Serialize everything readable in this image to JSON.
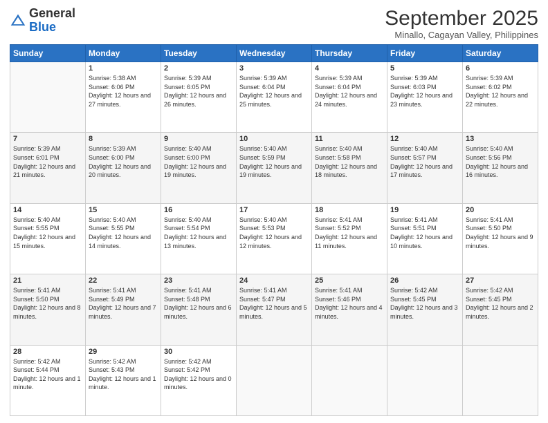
{
  "logo": {
    "general": "General",
    "blue": "Blue"
  },
  "header": {
    "month_title": "September 2025",
    "location": "Minallo, Cagayan Valley, Philippines"
  },
  "days_of_week": [
    "Sunday",
    "Monday",
    "Tuesday",
    "Wednesday",
    "Thursday",
    "Friday",
    "Saturday"
  ],
  "weeks": [
    [
      {
        "day": "",
        "sunrise": "",
        "sunset": "",
        "daylight": ""
      },
      {
        "day": "1",
        "sunrise": "Sunrise: 5:38 AM",
        "sunset": "Sunset: 6:06 PM",
        "daylight": "Daylight: 12 hours and 27 minutes."
      },
      {
        "day": "2",
        "sunrise": "Sunrise: 5:39 AM",
        "sunset": "Sunset: 6:05 PM",
        "daylight": "Daylight: 12 hours and 26 minutes."
      },
      {
        "day": "3",
        "sunrise": "Sunrise: 5:39 AM",
        "sunset": "Sunset: 6:04 PM",
        "daylight": "Daylight: 12 hours and 25 minutes."
      },
      {
        "day": "4",
        "sunrise": "Sunrise: 5:39 AM",
        "sunset": "Sunset: 6:04 PM",
        "daylight": "Daylight: 12 hours and 24 minutes."
      },
      {
        "day": "5",
        "sunrise": "Sunrise: 5:39 AM",
        "sunset": "Sunset: 6:03 PM",
        "daylight": "Daylight: 12 hours and 23 minutes."
      },
      {
        "day": "6",
        "sunrise": "Sunrise: 5:39 AM",
        "sunset": "Sunset: 6:02 PM",
        "daylight": "Daylight: 12 hours and 22 minutes."
      }
    ],
    [
      {
        "day": "7",
        "sunrise": "Sunrise: 5:39 AM",
        "sunset": "Sunset: 6:01 PM",
        "daylight": "Daylight: 12 hours and 21 minutes."
      },
      {
        "day": "8",
        "sunrise": "Sunrise: 5:39 AM",
        "sunset": "Sunset: 6:00 PM",
        "daylight": "Daylight: 12 hours and 20 minutes."
      },
      {
        "day": "9",
        "sunrise": "Sunrise: 5:40 AM",
        "sunset": "Sunset: 6:00 PM",
        "daylight": "Daylight: 12 hours and 19 minutes."
      },
      {
        "day": "10",
        "sunrise": "Sunrise: 5:40 AM",
        "sunset": "Sunset: 5:59 PM",
        "daylight": "Daylight: 12 hours and 19 minutes."
      },
      {
        "day": "11",
        "sunrise": "Sunrise: 5:40 AM",
        "sunset": "Sunset: 5:58 PM",
        "daylight": "Daylight: 12 hours and 18 minutes."
      },
      {
        "day": "12",
        "sunrise": "Sunrise: 5:40 AM",
        "sunset": "Sunset: 5:57 PM",
        "daylight": "Daylight: 12 hours and 17 minutes."
      },
      {
        "day": "13",
        "sunrise": "Sunrise: 5:40 AM",
        "sunset": "Sunset: 5:56 PM",
        "daylight": "Daylight: 12 hours and 16 minutes."
      }
    ],
    [
      {
        "day": "14",
        "sunrise": "Sunrise: 5:40 AM",
        "sunset": "Sunset: 5:55 PM",
        "daylight": "Daylight: 12 hours and 15 minutes."
      },
      {
        "day": "15",
        "sunrise": "Sunrise: 5:40 AM",
        "sunset": "Sunset: 5:55 PM",
        "daylight": "Daylight: 12 hours and 14 minutes."
      },
      {
        "day": "16",
        "sunrise": "Sunrise: 5:40 AM",
        "sunset": "Sunset: 5:54 PM",
        "daylight": "Daylight: 12 hours and 13 minutes."
      },
      {
        "day": "17",
        "sunrise": "Sunrise: 5:40 AM",
        "sunset": "Sunset: 5:53 PM",
        "daylight": "Daylight: 12 hours and 12 minutes."
      },
      {
        "day": "18",
        "sunrise": "Sunrise: 5:41 AM",
        "sunset": "Sunset: 5:52 PM",
        "daylight": "Daylight: 12 hours and 11 minutes."
      },
      {
        "day": "19",
        "sunrise": "Sunrise: 5:41 AM",
        "sunset": "Sunset: 5:51 PM",
        "daylight": "Daylight: 12 hours and 10 minutes."
      },
      {
        "day": "20",
        "sunrise": "Sunrise: 5:41 AM",
        "sunset": "Sunset: 5:50 PM",
        "daylight": "Daylight: 12 hours and 9 minutes."
      }
    ],
    [
      {
        "day": "21",
        "sunrise": "Sunrise: 5:41 AM",
        "sunset": "Sunset: 5:50 PM",
        "daylight": "Daylight: 12 hours and 8 minutes."
      },
      {
        "day": "22",
        "sunrise": "Sunrise: 5:41 AM",
        "sunset": "Sunset: 5:49 PM",
        "daylight": "Daylight: 12 hours and 7 minutes."
      },
      {
        "day": "23",
        "sunrise": "Sunrise: 5:41 AM",
        "sunset": "Sunset: 5:48 PM",
        "daylight": "Daylight: 12 hours and 6 minutes."
      },
      {
        "day": "24",
        "sunrise": "Sunrise: 5:41 AM",
        "sunset": "Sunset: 5:47 PM",
        "daylight": "Daylight: 12 hours and 5 minutes."
      },
      {
        "day": "25",
        "sunrise": "Sunrise: 5:41 AM",
        "sunset": "Sunset: 5:46 PM",
        "daylight": "Daylight: 12 hours and 4 minutes."
      },
      {
        "day": "26",
        "sunrise": "Sunrise: 5:42 AM",
        "sunset": "Sunset: 5:45 PM",
        "daylight": "Daylight: 12 hours and 3 minutes."
      },
      {
        "day": "27",
        "sunrise": "Sunrise: 5:42 AM",
        "sunset": "Sunset: 5:45 PM",
        "daylight": "Daylight: 12 hours and 2 minutes."
      }
    ],
    [
      {
        "day": "28",
        "sunrise": "Sunrise: 5:42 AM",
        "sunset": "Sunset: 5:44 PM",
        "daylight": "Daylight: 12 hours and 1 minute."
      },
      {
        "day": "29",
        "sunrise": "Sunrise: 5:42 AM",
        "sunset": "Sunset: 5:43 PM",
        "daylight": "Daylight: 12 hours and 1 minute."
      },
      {
        "day": "30",
        "sunrise": "Sunrise: 5:42 AM",
        "sunset": "Sunset: 5:42 PM",
        "daylight": "Daylight: 12 hours and 0 minutes."
      },
      {
        "day": "",
        "sunrise": "",
        "sunset": "",
        "daylight": ""
      },
      {
        "day": "",
        "sunrise": "",
        "sunset": "",
        "daylight": ""
      },
      {
        "day": "",
        "sunrise": "",
        "sunset": "",
        "daylight": ""
      },
      {
        "day": "",
        "sunrise": "",
        "sunset": "",
        "daylight": ""
      }
    ]
  ]
}
